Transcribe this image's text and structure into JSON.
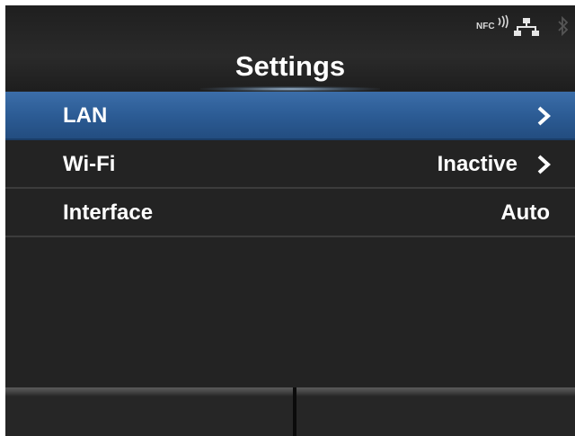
{
  "header": {
    "title": "Settings",
    "status": {
      "nfc_label": "NFC",
      "icons": [
        "nfc-icon",
        "lan-connected-icon",
        "bluetooth-icon"
      ]
    }
  },
  "menu": {
    "items": [
      {
        "label": "LAN",
        "value": "",
        "has_chevron": true,
        "selected": true
      },
      {
        "label": "Wi-Fi",
        "value": "Inactive",
        "has_chevron": true,
        "selected": false
      },
      {
        "label": "Interface",
        "value": "Auto",
        "has_chevron": false,
        "selected": false
      }
    ]
  },
  "footer": {
    "left_label": "",
    "right_label": ""
  },
  "colors": {
    "background": "#232323",
    "selection": "#2c5c95",
    "text": "#ffffff"
  }
}
